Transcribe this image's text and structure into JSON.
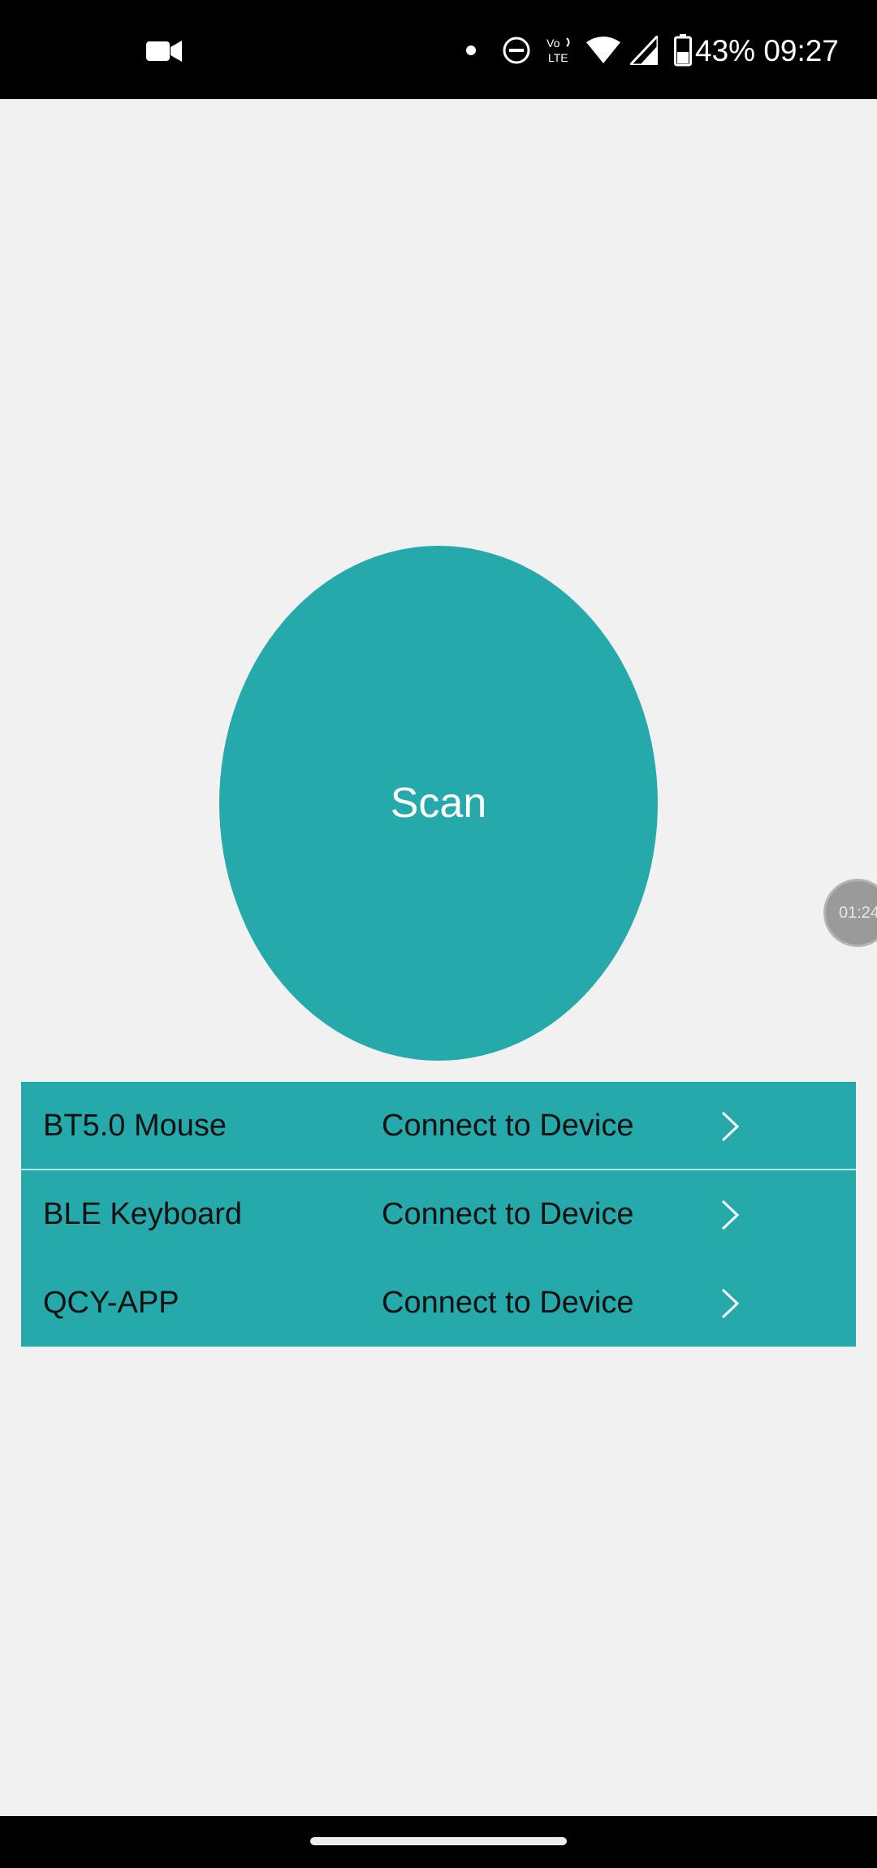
{
  "status_bar": {
    "status_text": "43% 09:27",
    "icons": [
      "video-camera-icon",
      "notification-dot-icon",
      "do-not-disturb-icon",
      "volte-icon",
      "wifi-icon",
      "cellular-signal-icon",
      "battery-icon"
    ]
  },
  "scan": {
    "label": "Scan"
  },
  "devices": [
    {
      "name": "BT5.0 Mouse",
      "action": "Connect to Device"
    },
    {
      "name": "BLE Keyboard",
      "action": "Connect to Device"
    },
    {
      "name": "QCY-APP",
      "action": "Connect to Device"
    }
  ],
  "floating_timer": {
    "text": "01:24"
  },
  "colors": {
    "accent": "#26a9aa",
    "background": "#f1f1f1",
    "bars": "#000000"
  }
}
